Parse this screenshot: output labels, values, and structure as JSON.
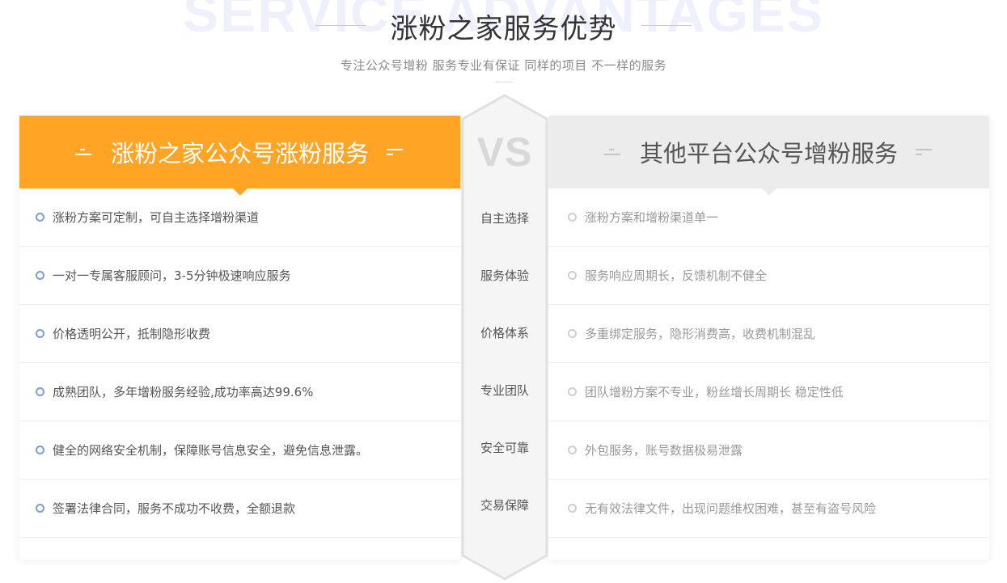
{
  "header": {
    "bg_text": "SERVICE ADVANTAGES",
    "title": "涨粉之家服务优势",
    "subtitle": "专注公众号增粉  服务专业有保证  同样的项目  不一样的服务"
  },
  "left_panel": {
    "title": "涨粉之家公众号涨粉服务",
    "accent_color": "#ffa425",
    "items": [
      "涨粉方案可定制，可自主选择增粉渠道",
      "一对一专属客服顾问，3-5分钟极速响应服务",
      "价格透明公开，抵制隐形收费",
      "成熟团队，多年增粉服务经验,成功率高达99.6%",
      "健全的网络安全机制，保障账号信息安全，避免信息泄露。",
      "签署法律合同，服务不成功不收费，全额退款"
    ]
  },
  "vs": {
    "label": "VS",
    "categories": [
      "自主选择",
      "服务体验",
      "价格体系",
      "专业团队",
      "安全可靠",
      "交易保障"
    ]
  },
  "right_panel": {
    "title": "其他平台公众号增粉服务",
    "accent_color": "#ececec",
    "items": [
      "涨粉方案和增粉渠道单一",
      "服务响应周期长，反馈机制不健全",
      "多重绑定服务，隐形消费高，收费机制混乱",
      "团队增粉方案不专业，粉丝增长周期长 稳定性低",
      "外包服务，账号数据极易泄露",
      "无有效法律文件，出现问题维权困难，甚至有盗号风险"
    ]
  }
}
